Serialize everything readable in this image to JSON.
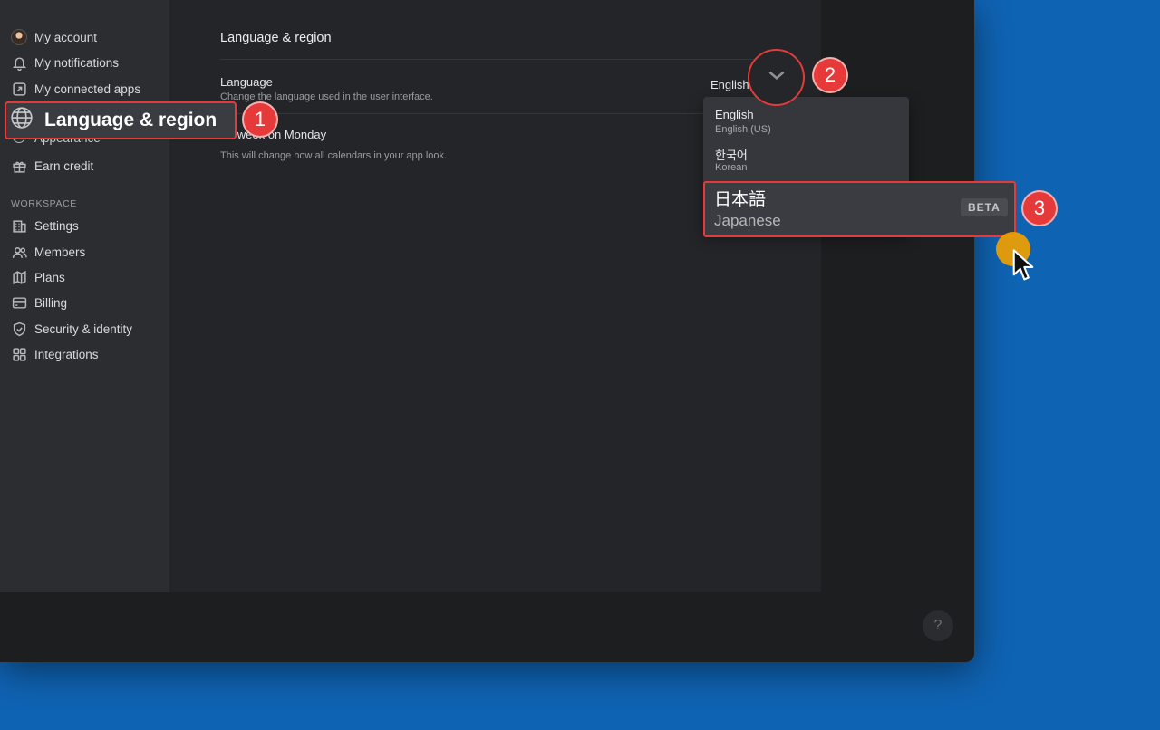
{
  "sidebar": {
    "items": [
      {
        "label": "My account",
        "icon": "avatar"
      },
      {
        "label": "My notifications",
        "icon": "bell-icon"
      },
      {
        "label": "My connected apps",
        "icon": "external-link-icon"
      },
      {
        "label": "Language & region",
        "icon": "globe-icon"
      },
      {
        "label": "Appearance",
        "icon": "palette-icon"
      },
      {
        "label": "Earn credit",
        "icon": "gift-icon"
      }
    ],
    "workspace_label": "WORKSPACE",
    "workspace_items": [
      {
        "label": "Settings",
        "icon": "building-icon"
      },
      {
        "label": "Members",
        "icon": "users-icon"
      },
      {
        "label": "Plans",
        "icon": "map-icon"
      },
      {
        "label": "Billing",
        "icon": "credit-card-icon"
      },
      {
        "label": "Security & identity",
        "icon": "shield-icon"
      },
      {
        "label": "Integrations",
        "icon": "grid-icon"
      }
    ]
  },
  "main": {
    "title": "Language & region",
    "language": {
      "title": "Language",
      "description": "Change the language used in the user interface.",
      "value": "English"
    },
    "week": {
      "title_visible": "art week on Monday",
      "description": "This will change how all calendars in your app look."
    }
  },
  "dropdown": {
    "options": [
      {
        "name": "English",
        "sub": "English (US)"
      },
      {
        "name": "한국어",
        "sub": "Korean"
      },
      {
        "name": "日本語",
        "sub": "Japanese",
        "badge": "BETA"
      }
    ]
  },
  "annotations": {
    "step1": "1",
    "step2": "2",
    "step3": "3"
  },
  "help_label": "?",
  "colors": {
    "accent_red": "#e63a3a",
    "desktop_blue": "#0f63b3",
    "cursor_highlight": "#f0a000"
  }
}
